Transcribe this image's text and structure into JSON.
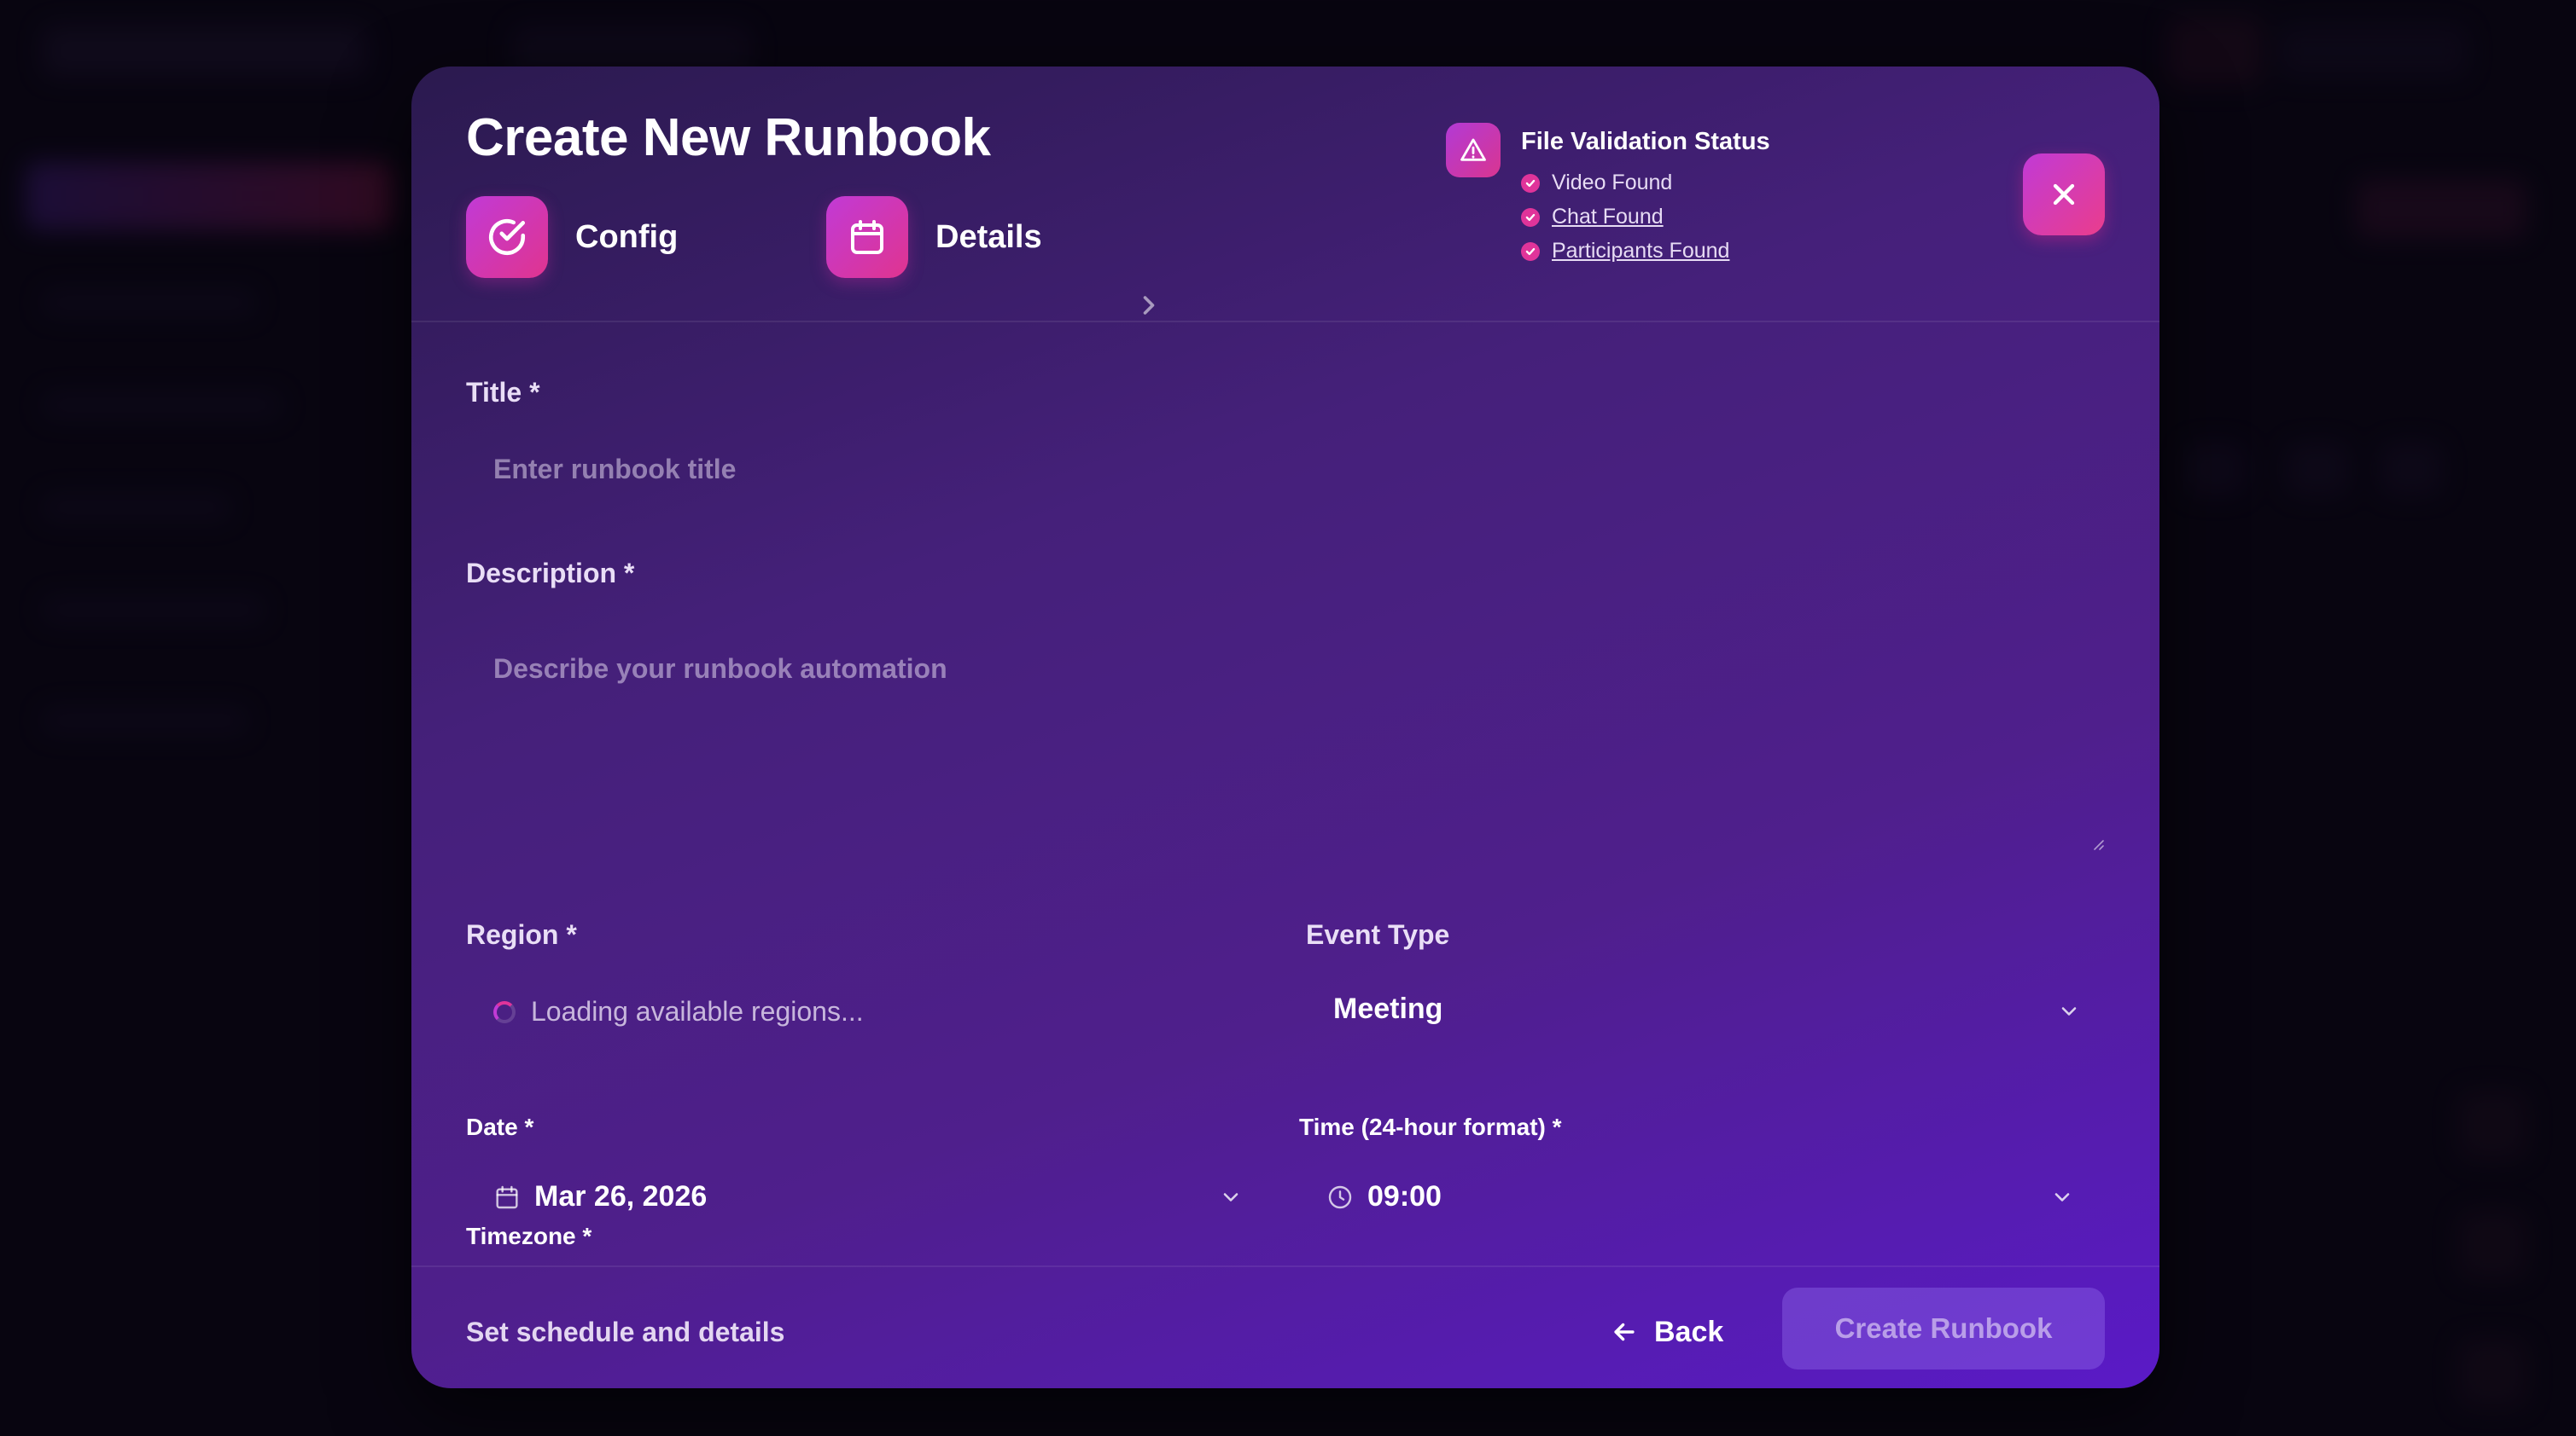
{
  "modal": {
    "title": "Create New Runbook",
    "steps": [
      {
        "label": "Config",
        "icon": "check-circle-icon"
      },
      {
        "label": "Details",
        "icon": "calendar-icon"
      }
    ],
    "close_icon": "close-icon"
  },
  "validation": {
    "title": "File Validation Status",
    "icon": "warning-triangle-icon",
    "items": [
      {
        "label": "Video Found"
      },
      {
        "label": "Chat Found"
      },
      {
        "label": "Participants Found"
      }
    ]
  },
  "form": {
    "title": {
      "label": "Title *",
      "placeholder": "Enter runbook title"
    },
    "description": {
      "label": "Description *",
      "placeholder": "Describe your runbook automation"
    },
    "region": {
      "label": "Region *",
      "loading_text": "Loading available regions..."
    },
    "event_type": {
      "label": "Event Type",
      "value": "Meeting"
    },
    "date": {
      "label": "Date *",
      "value": "Mar 26, 2026"
    },
    "time": {
      "label": "Time (24-hour format) *",
      "value": "09:00"
    },
    "timezone": {
      "label": "Timezone *"
    }
  },
  "footer": {
    "hint": "Set schedule and details",
    "back_label": "Back",
    "create_label": "Create Runbook"
  },
  "colors": {
    "accent_start": "#c13ad6",
    "accent_end": "#e0348f",
    "modal_bg": "#4f1f8c"
  }
}
